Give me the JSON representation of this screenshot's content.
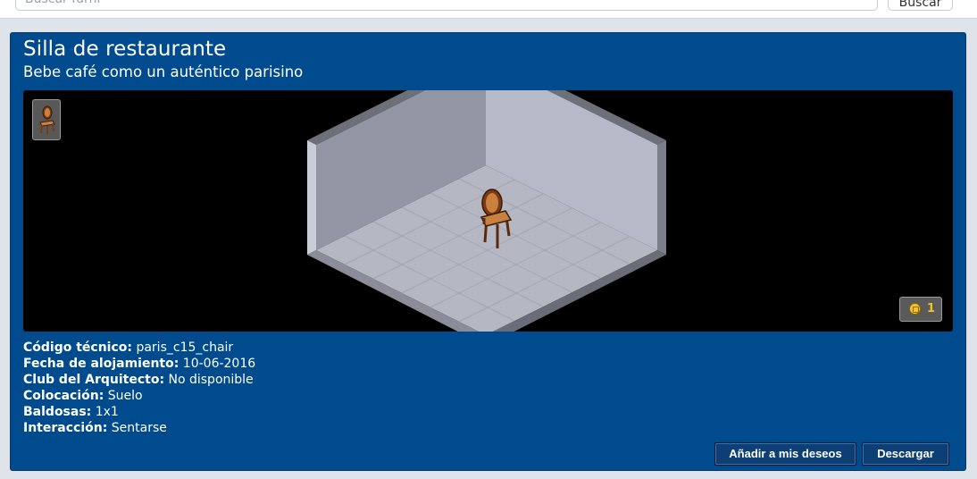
{
  "search": {
    "placeholder": "Buscar furni",
    "button_label": "Buscar"
  },
  "item": {
    "title": "Silla de restaurante",
    "subtitle": "Bebe café como un auténtico parisino",
    "price": "1",
    "icons": {
      "thumbnail": "chair-thumbnail-icon",
      "currency": "credit-coin-icon"
    }
  },
  "details": [
    {
      "label": "Código técnico:",
      "value": "paris_c15_chair"
    },
    {
      "label": "Fecha de alojamiento:",
      "value": "10-06-2016"
    },
    {
      "label": "Club del Arquitecto:",
      "value": "No disponible"
    },
    {
      "label": "Colocación:",
      "value": "Suelo"
    },
    {
      "label": "Baldosas:",
      "value": "1x1"
    },
    {
      "label": "Interacción:",
      "value": "Sentarse"
    }
  ],
  "actions": {
    "wishlist_label": "Añadir a mis deseos",
    "download_label": "Descargar"
  },
  "colors": {
    "panel_bg": "#004b8d",
    "viewer_bg": "#000000",
    "coin": "#f2c230"
  }
}
